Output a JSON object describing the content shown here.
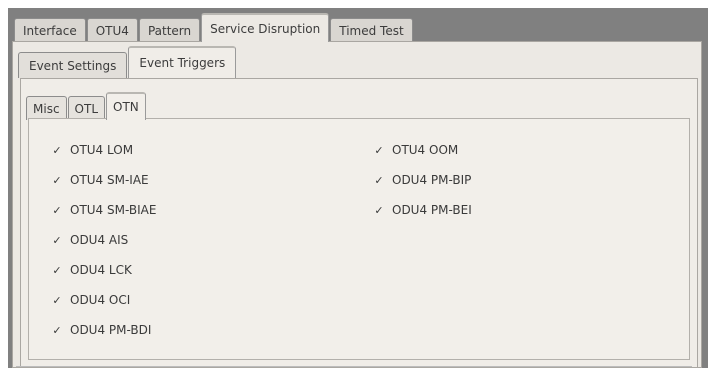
{
  "top_tabs": [
    "Interface",
    "OTU4",
    "Pattern",
    "Service Disruption",
    "Timed Test"
  ],
  "mid_tabs": [
    "Event Settings",
    "Event Triggers"
  ],
  "inner_tabs": [
    "Misc",
    "OTL",
    "OTN"
  ],
  "check_mark": "✓",
  "left_checkboxes": [
    {
      "label": "OTU4 LOM",
      "checked": true
    },
    {
      "label": "OTU4 SM-IAE",
      "checked": true
    },
    {
      "label": "OTU4 SM-BIAE",
      "checked": true
    },
    {
      "label": "ODU4 AIS",
      "checked": true
    },
    {
      "label": "ODU4 LCK",
      "checked": true
    },
    {
      "label": "ODU4 OCI",
      "checked": true
    },
    {
      "label": "ODU4 PM-BDI",
      "checked": true
    }
  ],
  "right_checkboxes": [
    {
      "label": "OTU4 OOM",
      "checked": true
    },
    {
      "label": "ODU4 PM-BIP",
      "checked": true
    },
    {
      "label": "ODU4 PM-BEI",
      "checked": true
    }
  ]
}
